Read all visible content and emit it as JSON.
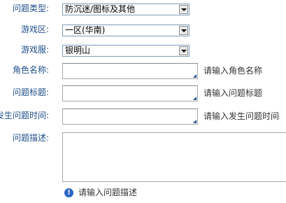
{
  "form": {
    "problem_type": {
      "label": "问题类型:",
      "value": "防沉迷/图标及其他"
    },
    "game_zone": {
      "label": "游戏区:",
      "value": "一区(华南)"
    },
    "game_server": {
      "label": "游戏服:",
      "value": "银明山"
    },
    "role_name": {
      "label": "角色名称:",
      "hint": "请输入角色名称",
      "value": ""
    },
    "problem_title": {
      "label": "问题标题:",
      "hint": "请输入问题标题",
      "value": ""
    },
    "problem_time": {
      "label": "发生问题时间:",
      "hint": "请输入发生问题时间",
      "value": ""
    },
    "problem_desc": {
      "label": "问题描述:",
      "hint": "请输入问题描述",
      "value": ""
    }
  },
  "icons": {
    "info": "info-icon"
  },
  "colors": {
    "label": "#1f4e8c",
    "info_icon": "#2b66c2"
  }
}
